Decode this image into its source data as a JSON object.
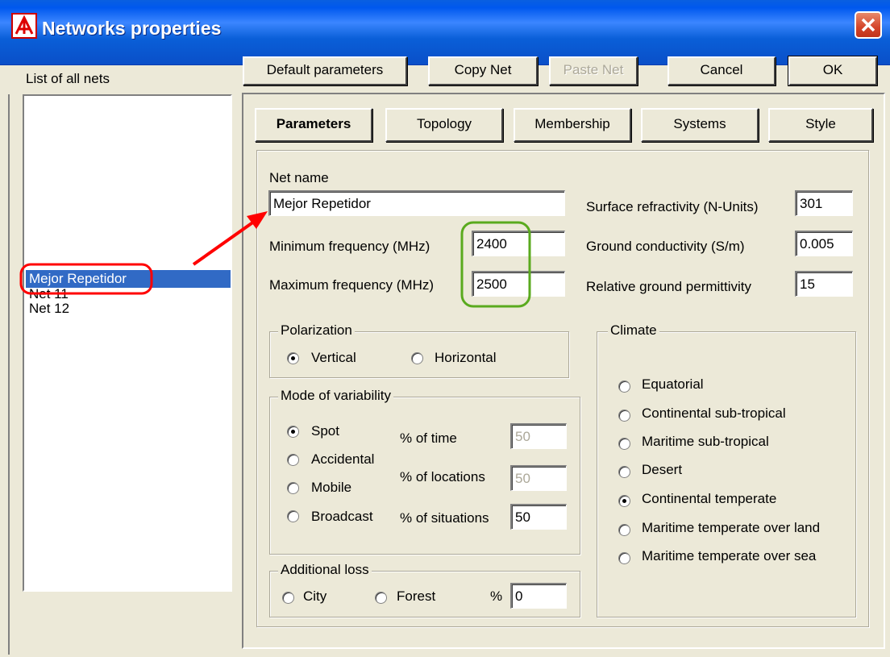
{
  "window": {
    "title": "Networks properties",
    "close_icon": "close-icon"
  },
  "left": {
    "list_label": "List of all nets",
    "nets": [
      "Mejor Repetidor",
      "Net 11",
      "Net 12"
    ],
    "selected_index": 0
  },
  "toolbar": {
    "default_label": "Default parameters",
    "copy_label": "Copy Net",
    "paste_label": "Paste Net",
    "cancel_label": "Cancel",
    "ok_label": "OK"
  },
  "tabs": [
    "Parameters",
    "Topology",
    "Membership",
    "Systems",
    "Style"
  ],
  "params": {
    "net_name_label": "Net name",
    "net_name_value": "Mejor Repetidor",
    "min_freq_label": "Minimum frequency (MHz)",
    "min_freq_value": "2400",
    "max_freq_label": "Maximum frequency (MHz)",
    "max_freq_value": "2500",
    "refractivity_label": "Surface refractivity (N-Units)",
    "refractivity_value": "301",
    "conductivity_label": "Ground conductivity (S/m)",
    "conductivity_value": "0.005",
    "permittivity_label": "Relative ground permittivity",
    "permittivity_value": "15"
  },
  "polarization": {
    "title": "Polarization",
    "vertical": "Vertical",
    "horizontal": "Horizontal",
    "selected": "Vertical"
  },
  "variability": {
    "title": "Mode of variability",
    "modes": [
      "Spot",
      "Accidental",
      "Mobile",
      "Broadcast"
    ],
    "selected": "Spot",
    "time_label": "% of time",
    "time_value": "50",
    "locations_label": "% of locations",
    "locations_value": "50",
    "situations_label": "% of situations",
    "situations_value": "50"
  },
  "loss": {
    "title": "Additional loss",
    "city": "City",
    "forest": "Forest",
    "pct_label": "%",
    "pct_value": "0"
  },
  "climate": {
    "title": "Climate",
    "options": [
      "Equatorial",
      "Continental sub-tropical",
      "Maritime sub-tropical",
      "Desert",
      "Continental temperate",
      "Maritime temperate over land",
      "Maritime temperate over sea"
    ],
    "selected": "Continental temperate"
  },
  "colors": {
    "annotation_red": "#ff0000",
    "annotation_green": "#5aaa1e",
    "selection": "#316ac5",
    "titlebar": "#0a5fd8"
  }
}
